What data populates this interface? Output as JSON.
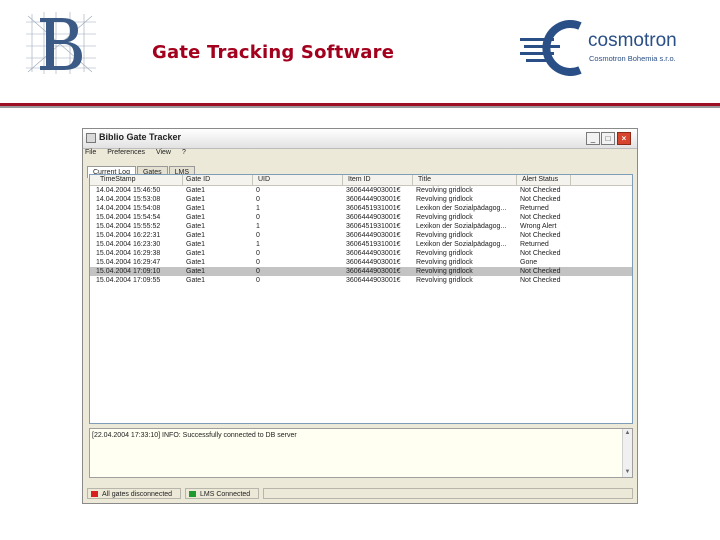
{
  "slide": {
    "title": "Gate Tracking Software",
    "brand_name": "cosmotron",
    "brand_sub": "Cosmotron Bohemia s.r.o."
  },
  "colors": {
    "title_red": "#a3001d",
    "brand_blue": "#2a4f86",
    "status_red": "#d91f1f",
    "status_green": "#1e9a2e",
    "selected_row": "#c3c3c3"
  },
  "window": {
    "title": "Biblio Gate Tracker",
    "menu": [
      "File",
      "Preferences",
      "View",
      "?"
    ],
    "tabs": [
      "Current Log",
      "Gates",
      "LMS"
    ],
    "active_tab": "Current Log",
    "columns": [
      "TimeStamp",
      "Gate ID",
      "UID",
      "Item ID",
      "Title",
      "Alert Status"
    ],
    "rows": [
      [
        "14.04.2004 15:46:50",
        "Gate1",
        "0",
        "3606444903001€",
        "Revolving gridlock",
        "Not Checked"
      ],
      [
        "14.04.2004 15:53:08",
        "Gate1",
        "0",
        "3606444903001€",
        "Revolving gridlock",
        "Not Checked"
      ],
      [
        "14.04.2004 15:54:08",
        "Gate1",
        "1",
        "3606451931001€",
        "Lexikon der Sozialpädagog...",
        "Returned"
      ],
      [
        "15.04.2004 15:54:54",
        "Gate1",
        "0",
        "3606444903001€",
        "Revolving gridlock",
        "Not Checked"
      ],
      [
        "15.04.2004 15:55:52",
        "Gate1",
        "1",
        "3606451931001€",
        "Lexikon der Sozialpädagog...",
        "Wrong Alert"
      ],
      [
        "15.04.2004 16:22:31",
        "Gate1",
        "0",
        "3606444903001€",
        "Revolving gridlock",
        "Not Checked"
      ],
      [
        "15.04.2004 16:23:30",
        "Gate1",
        "1",
        "3606451931001€",
        "Lexikon der Sozialpädagog...",
        "Returned"
      ],
      [
        "15.04.2004 16:29:38",
        "Gate1",
        "0",
        "3606444903001€",
        "Revolving gridlock",
        "Not Checked"
      ],
      [
        "15.04.2004 16:29:47",
        "Gate1",
        "0",
        "3606444903001€",
        "Revolving gridlock",
        "Gone"
      ],
      [
        "15.04.2004 17:09:10",
        "Gate1",
        "0",
        "3606444903001€",
        "Revolving gridlock",
        "Not Checked"
      ],
      [
        "15.04.2004 17:09:55",
        "Gate1",
        "0",
        "3606444903001€",
        "Revolving gridlock",
        "Not Checked"
      ]
    ],
    "selected_row_index": 9,
    "log_line": "[22.04.2004 17:33:10] INFO: Successfully connected to DB server",
    "status": [
      {
        "text": "All gates disconnected",
        "color": "#d91f1f"
      },
      {
        "text": "LMS Connected",
        "color": "#1e9a2e"
      }
    ]
  }
}
